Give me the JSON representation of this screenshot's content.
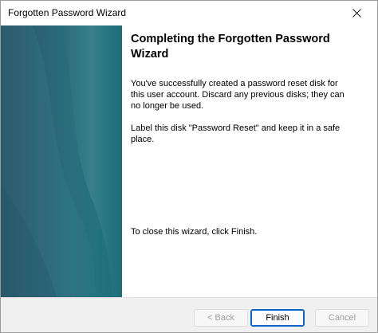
{
  "window": {
    "title": "Forgotten Password Wizard"
  },
  "content": {
    "heading": "Completing the Forgotten Password Wizard",
    "paragraph1": "You've successfully created a password reset disk for this user account. Discard any previous disks; they can no longer be used.",
    "paragraph2": "Label this disk \"Password Reset\" and keep it in a safe place.",
    "paragraph3": "To close this wizard, click Finish."
  },
  "buttons": {
    "back": "< Back",
    "finish": "Finish",
    "cancel": "Cancel"
  },
  "colors": {
    "side_panel": "#2e6f7f",
    "accent": "#0a64c8"
  },
  "icons": {
    "close": "close-icon"
  }
}
